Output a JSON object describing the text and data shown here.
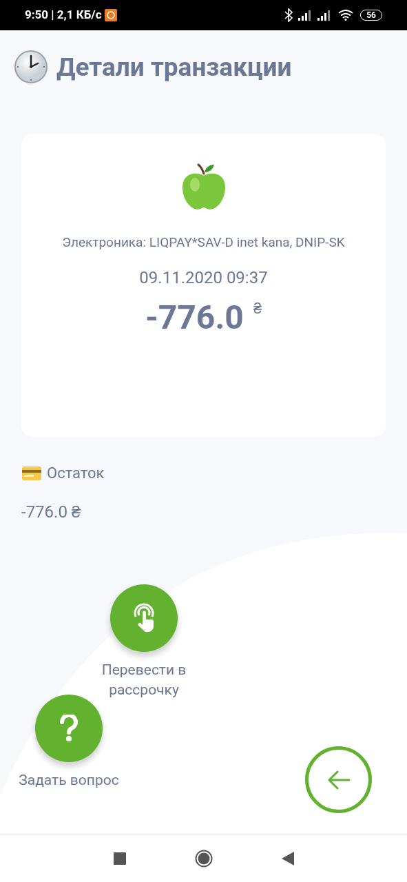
{
  "status_bar": {
    "time": "9:50 | 2,1 КБ/с",
    "battery": "56"
  },
  "title": "Детали транзакции",
  "transaction": {
    "merchant": "Электроника: LIQPAY*SAV-D inet kana, DNIP-SK",
    "datetime": "09.11.2020 09:37",
    "amount": "-776.0",
    "currency": "₴"
  },
  "balance": {
    "label": "Остаток",
    "value": "-776.0 ₴"
  },
  "actions": [
    {
      "kind": "installment",
      "label": "Перевести в рассрочку"
    },
    {
      "kind": "question",
      "label": "Задать вопрос"
    }
  ]
}
